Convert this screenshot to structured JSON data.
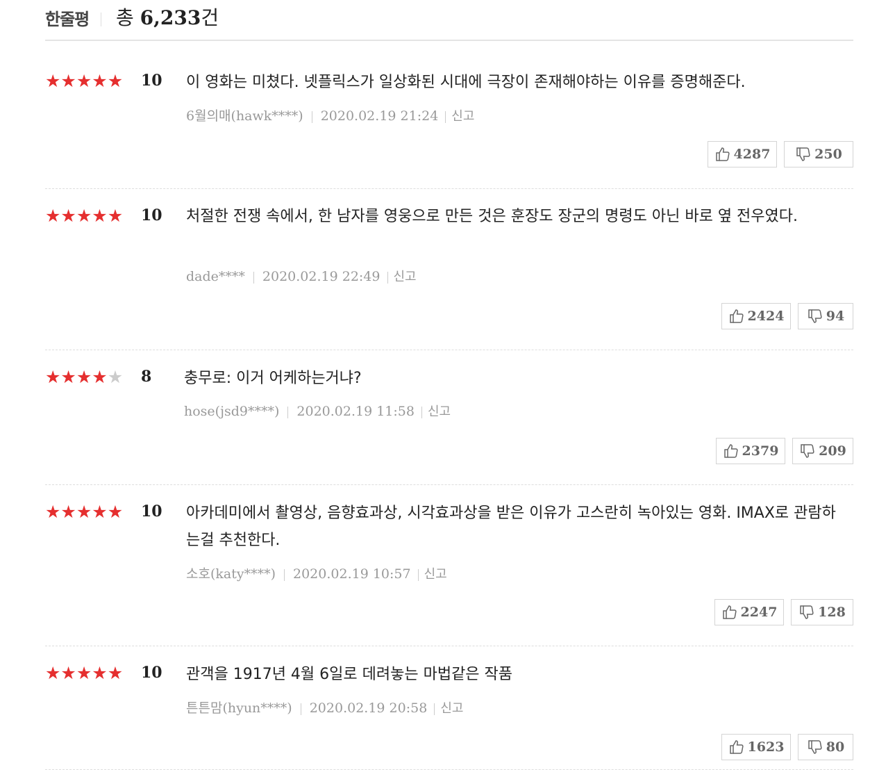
{
  "header": {
    "title": "한줄평",
    "total_prefix": "총 ",
    "total_count": "6,233",
    "total_suffix": "건"
  },
  "colors": {
    "star_on": "#e52f2f",
    "star_off": "#cccccc"
  },
  "reviews": [
    {
      "stars": 5,
      "score": "10",
      "text": "이 영화는 미쳤다. 넷플릭스가 일상화된 시대에 극장이 존재해야하는 이유를 증명해준다.",
      "author": "6월의매(hawk****)",
      "datetime": "2020.02.19 21:24",
      "report": "신고",
      "likes": "4287",
      "dislikes": "250"
    },
    {
      "stars": 5,
      "score": "10",
      "text": "처절한 전쟁 속에서, 한 남자를 영웅으로 만든 것은 훈장도 장군의 명령도 아닌 바로 옆 전우였다.",
      "author": "dade****",
      "datetime": "2020.02.19 22:49",
      "report": "신고",
      "likes": "2424",
      "dislikes": "94"
    },
    {
      "stars": 4,
      "score": "8",
      "text": "충무로: 이거 어케하는거냐?",
      "author": "hose(jsd9****)",
      "datetime": "2020.02.19 11:58",
      "report": "신고",
      "likes": "2379",
      "dislikes": "209"
    },
    {
      "stars": 5,
      "score": "10",
      "text": "아카데미에서 촬영상, 음향효과상, 시각효과상을 받은 이유가 고스란히 녹아있는 영화. IMAX로 관람하는걸 추천한다.",
      "author": "소호(katy****)",
      "datetime": "2020.02.19 10:57",
      "report": "신고",
      "likes": "2247",
      "dislikes": "128"
    },
    {
      "stars": 5,
      "score": "10",
      "text": "관객을 1917년 4월 6일로 데려놓는 마법같은 작품",
      "author": "튼튼맘(hyun****)",
      "datetime": "2020.02.19 20:58",
      "report": "신고",
      "likes": "1623",
      "dislikes": "80"
    }
  ]
}
